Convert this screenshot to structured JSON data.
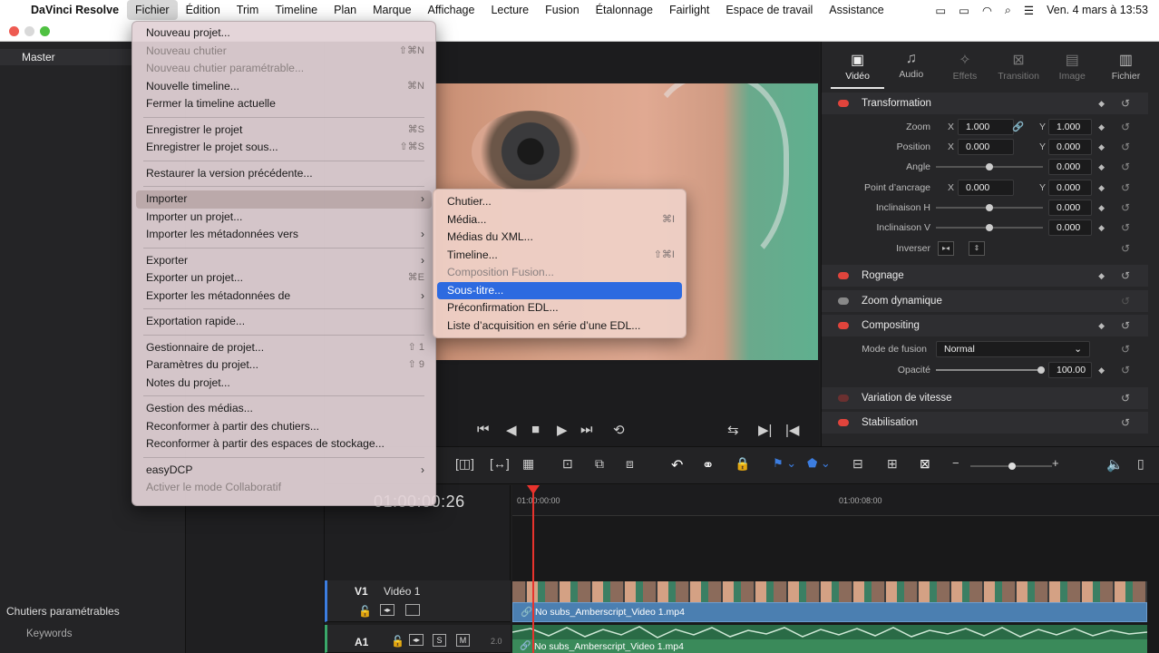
{
  "menubar": {
    "app": "DaVinci Resolve",
    "items": [
      "Fichier",
      "Édition",
      "Trim",
      "Timeline",
      "Plan",
      "Marque",
      "Affichage",
      "Lecture",
      "Fusion",
      "Étalonnage",
      "Fairlight",
      "Espace de travail",
      "Assistance"
    ],
    "datetime": "Ven. 4 mars à  13:53"
  },
  "left": {
    "master": "Master",
    "smart_bins": "Chutiers paramétrables",
    "keywords": "Keywords"
  },
  "file_menu": {
    "items": [
      {
        "label": "Nouveau projet...",
        "shortcut": "",
        "disabled": false
      },
      {
        "label": "Nouveau chutier",
        "shortcut": "⇧⌘N",
        "disabled": true
      },
      {
        "label": "Nouveau chutier paramétrable...",
        "shortcut": "",
        "disabled": true
      },
      {
        "label": "Nouvelle timeline...",
        "shortcut": "⌘N",
        "disabled": false
      },
      {
        "label": "Fermer la timeline actuelle",
        "shortcut": "",
        "disabled": false
      },
      {
        "label": "Enregistrer le projet",
        "shortcut": "⌘S",
        "disabled": false
      },
      {
        "label": "Enregistrer le projet sous...",
        "shortcut": "⇧⌘S",
        "disabled": false
      },
      {
        "label": "Restaurer la version précédente...",
        "shortcut": "",
        "disabled": false
      },
      {
        "label": "Importer",
        "shortcut": "",
        "disabled": false
      },
      {
        "label": "Importer un projet...",
        "shortcut": "",
        "disabled": false
      },
      {
        "label": "Importer les métadonnées vers",
        "shortcut": "",
        "disabled": false
      },
      {
        "label": "Exporter",
        "shortcut": "",
        "disabled": false
      },
      {
        "label": "Exporter un projet...",
        "shortcut": "⌘E",
        "disabled": false
      },
      {
        "label": "Exporter les métadonnées de",
        "shortcut": "",
        "disabled": false
      },
      {
        "label": "Exportation rapide...",
        "shortcut": "",
        "disabled": false
      },
      {
        "label": "Gestionnaire de projet...",
        "shortcut": "⇧ 1",
        "disabled": false
      },
      {
        "label": "Paramètres du projet...",
        "shortcut": "⇧ 9",
        "disabled": false
      },
      {
        "label": "Notes du projet...",
        "shortcut": "",
        "disabled": false
      },
      {
        "label": "Gestion des médias...",
        "shortcut": "",
        "disabled": false
      },
      {
        "label": "Reconformer à partir des chutiers...",
        "shortcut": "",
        "disabled": false
      },
      {
        "label": "Reconformer à partir des espaces de stockage...",
        "shortcut": "",
        "disabled": false
      },
      {
        "label": "easyDCP",
        "shortcut": "",
        "disabled": false
      },
      {
        "label": "Activer le mode Collaboratif",
        "shortcut": "",
        "disabled": true
      }
    ]
  },
  "import_submenu": {
    "items": [
      {
        "label": "Chutier...",
        "shortcut": "",
        "disabled": false
      },
      {
        "label": "Média...",
        "shortcut": "⌘I",
        "disabled": false
      },
      {
        "label": "Médias du XML...",
        "shortcut": "",
        "disabled": false
      },
      {
        "label": "Timeline...",
        "shortcut": "⇧⌘I",
        "disabled": false
      },
      {
        "label": "Composition Fusion...",
        "shortcut": "",
        "disabled": true
      },
      {
        "label": "Sous-titre...",
        "shortcut": "",
        "disabled": false
      },
      {
        "label": "Préconfirmation EDL...",
        "shortcut": "",
        "disabled": false
      },
      {
        "label": "Liste d’acquisition en série d’une EDL...",
        "shortcut": "",
        "disabled": false
      }
    ],
    "selected": "Sous-titre..."
  },
  "inspector": {
    "tabs": [
      "Vidéo",
      "Audio",
      "Effets",
      "Transition",
      "Image",
      "Fichier"
    ],
    "active_tab": "Vidéo",
    "transformation": "Transformation",
    "zoom_label": "Zoom",
    "zoom_x": "1.000",
    "zoom_y": "1.000",
    "position_label": "Position",
    "pos_x": "0.000",
    "pos_y": "0.000",
    "angle_label": "Angle",
    "angle": "0.000",
    "anchor_label": "Point d’ancrage",
    "anchor_x": "0.000",
    "anchor_y": "0.000",
    "pitch_label": "Inclinaison H",
    "pitch": "0.000",
    "yaw_label": "Inclinaison V",
    "yaw": "0.000",
    "flip_label": "Inverser",
    "crop": "Rognage",
    "dynamic_zoom": "Zoom dynamique",
    "compositing": "Compositing",
    "blend_label": "Mode de fusion",
    "blend_value": "Normal",
    "opacity_label": "Opacité",
    "opacity": "100.00",
    "speed": "Variation de vitesse",
    "stabilization": "Stabilisation",
    "x": "X",
    "y": "Y"
  },
  "timeline": {
    "timecode": "01:00:00:26",
    "ruler_start": "01:00:00:00",
    "ruler_mid": "01:00:08:00",
    "v1": "V1",
    "v1_name": "Vidéo 1",
    "a1": "A1",
    "a1_level": "2.0",
    "video_clip": "No subs_Amberscript_Video 1.mp4",
    "audio_clip": "No subs_Amberscript_Video 1.mp4",
    "s_btn": "S",
    "m_btn": "M"
  },
  "colors": {
    "accent": "#2d6ae0",
    "playhead": "#e8332d",
    "clip_video": "#4b7fb1",
    "clip_audio": "#3a8a5a",
    "section_dot": "#e0443c"
  }
}
